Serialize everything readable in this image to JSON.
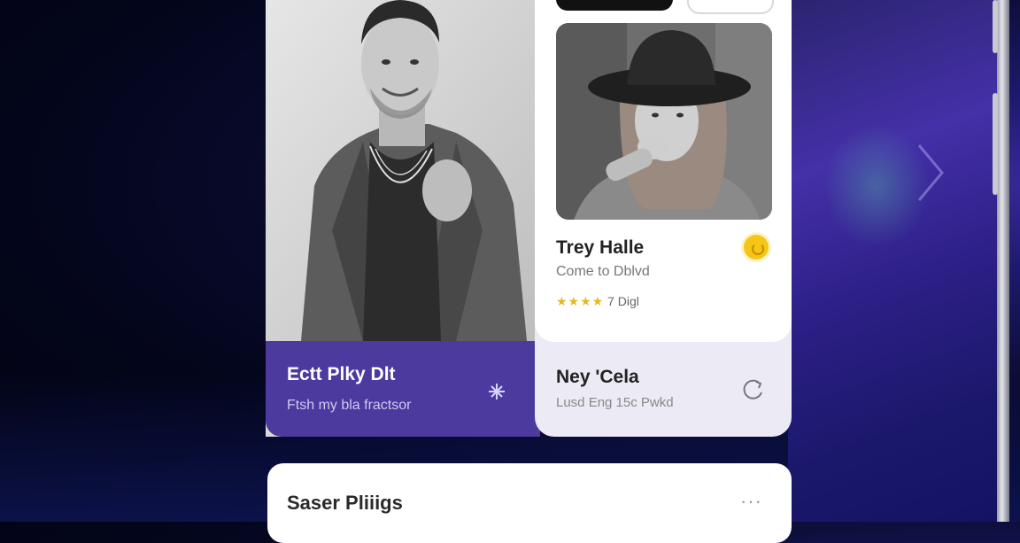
{
  "left_card": {
    "title": "Ectt Plky Dlt",
    "subtitle": "Ftsh my bla fractsor"
  },
  "right_card": {
    "name": "Trey Halle",
    "subtitle": "Come to Dblvd",
    "stars": "★★★★",
    "rating_text": "7 Digl",
    "bottom_title": "Ney 'Cela",
    "bottom_subtitle": "Lusd Eng 15c Pwkd"
  },
  "bottom_card": {
    "title": "Saser Pliiigs",
    "more": "···"
  },
  "colors": {
    "accent_purple": "#4c3a9e",
    "star_yellow": "#e7b71c",
    "badge_yellow": "#f5c518"
  },
  "icons": {
    "left_caption_icon": "sparkle-icon",
    "right_card_badge": "yellow-badge-icon",
    "right_bottom_icon": "refresh-icon",
    "side_chevron": "chevron-right-icon",
    "bottom_more": "more-horizontal-icon"
  }
}
